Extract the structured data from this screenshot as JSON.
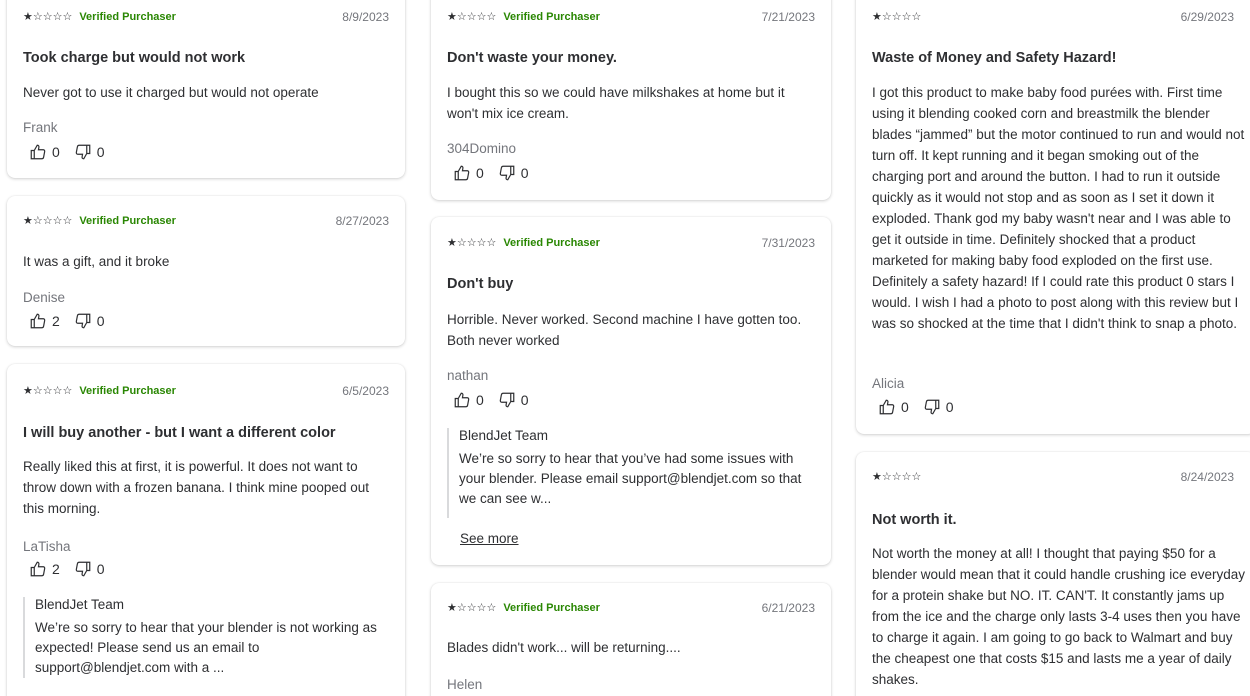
{
  "reviews": {
    "r1": {
      "stars": 1,
      "verified": "Verified Purchaser",
      "date": "8/9/2023",
      "title": "Took charge but would not work",
      "body": "Never got to use it charged but would not operate",
      "author": "Frank",
      "helpful": "0",
      "unhelpful": "0"
    },
    "r2": {
      "stars": 1,
      "verified": "Verified Purchaser",
      "date": "8/27/2023",
      "title": "",
      "body": "It was a gift, and it broke",
      "author": "Denise",
      "helpful": "2",
      "unhelpful": "0"
    },
    "r3": {
      "stars": 1,
      "verified": "Verified Purchaser",
      "date": "6/5/2023",
      "title": "I will buy another - but I want a different color",
      "body": "Really liked this at first, it is powerful. It does not want to throw down with a frozen banana. I think mine pooped out this morning.",
      "author": "LaTisha",
      "helpful": "2",
      "unhelpful": "0",
      "reply_team": "BlendJet Team",
      "reply_text": "We’re so sorry to hear that your blender is not working as expected! Please send us an email to support@blendjet.com with a ..."
    },
    "r4": {
      "stars": 1,
      "verified": "Verified Purchaser",
      "date": "7/21/2023",
      "title": "Don't waste your money.",
      "body": "I bought this so we could have milkshakes at home but it won't mix ice cream.",
      "author": "304Domino",
      "helpful": "0",
      "unhelpful": "0"
    },
    "r5": {
      "stars": 1,
      "verified": "Verified Purchaser",
      "date": "7/31/2023",
      "title": "Don't buy",
      "body": "Horrible. Never worked. Second machine I have gotten too. Both never worked",
      "author": "nathan",
      "helpful": "0",
      "unhelpful": "0",
      "reply_team": "BlendJet Team",
      "reply_text": "We’re so sorry to hear that you’ve had some issues with your blender. Please email support@blendjet.com so that we can see w...",
      "see_more": "See more"
    },
    "r6": {
      "stars": 1,
      "verified": "Verified Purchaser",
      "date": "6/21/2023",
      "title": "",
      "body": "Blades didn't work... will be returning....",
      "author": "Helen"
    },
    "r7": {
      "stars": 1,
      "verified": "",
      "date": "6/29/2023",
      "title": "Waste of Money and Safety Hazard!",
      "body": "I got this product to make baby food purées with. First time using it blending cooked corn and breastmilk the blender blades “jammed” but the motor continued to run and would not turn off. It kept running and it began smoking out of the charging port and around the button. I had to run it outside quickly as it would not stop and as soon as I set it down it exploded. Thank god my baby wasn't near and I was able to get it outside in time. Definitely shocked that a product marketed for making baby food exploded on the first use. Definitely a safety hazard! If I could rate this product 0 stars I would. I wish I had a photo to post along with this review but I was so shocked at the time that I didn't think to snap a photo.",
      "author": "Alicia",
      "helpful": "0",
      "unhelpful": "0"
    },
    "r8": {
      "stars": 1,
      "verified": "",
      "date": "8/24/2023",
      "title": "Not worth it.",
      "body": "Not worth the money at all! I thought that paying $50 for a blender would mean that it could handle crushing ice everyday for a protein shake but NO. IT. CAN'T. It constantly jams up from the ice and the charge only lasts 3-4 uses then you have to charge it again. I am going to go back to Walmart and buy the cheapest one that costs $15 and lasts me a year of daily shakes."
    }
  },
  "icons": {
    "helpful": "thumbs-up-icon",
    "unhelpful": "thumbs-down-icon",
    "star": "star-icon"
  }
}
